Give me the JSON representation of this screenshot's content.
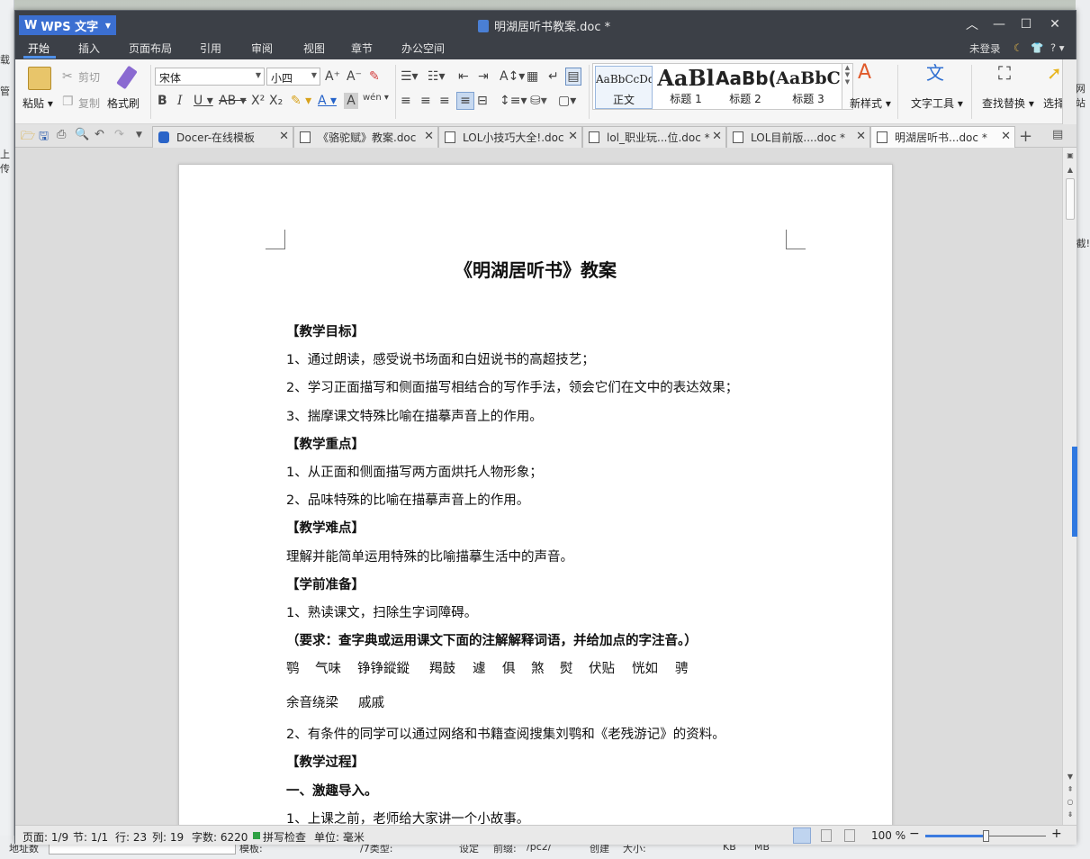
{
  "background": {
    "left_fragments": [
      "载",
      "管",
      "上传"
    ],
    "right_fragments": [
      "网站",
      "截!"
    ],
    "bottom_fragments": [
      "地址数",
      "模板:",
      "/7类型:",
      "设定",
      "前缀:",
      "/pc2/",
      "创建",
      "大小:",
      "KB",
      "MB"
    ]
  },
  "app": {
    "logo_label": "WPS 文字",
    "document_title": "明湖居听书教案.doc *"
  },
  "menu": {
    "items": [
      "开始",
      "插入",
      "页面布局",
      "引用",
      "审阅",
      "视图",
      "章节",
      "办公空间"
    ],
    "login": "未登录"
  },
  "ribbon": {
    "paste": "粘贴",
    "cut": "剪切",
    "copy": "复制",
    "format_painter": "格式刷",
    "font_name": "宋体",
    "font_size": "小四",
    "styles": [
      {
        "sample": "AaBbCcDd",
        "name": "正文"
      },
      {
        "sample": "AaBl",
        "name": "标题 1"
      },
      {
        "sample": "AaBb(",
        "name": "标题 2"
      },
      {
        "sample": "AaBbC",
        "name": "标题 3"
      }
    ],
    "new_style": "新样式",
    "text_tools": "文字工具",
    "find_replace": "查找替换",
    "select": "选择"
  },
  "tabs": [
    {
      "label": "Docer-在线模板",
      "active": false
    },
    {
      "label": "《骆驼赋》教案.doc",
      "active": false
    },
    {
      "label": "LOL小技巧大全!.doc",
      "active": false
    },
    {
      "label": "lol_职业玩...位.doc *",
      "active": false
    },
    {
      "label": "LOL目前版....doc *",
      "active": false
    },
    {
      "label": "明湖居听书...doc *",
      "active": true
    }
  ],
  "document": {
    "title": "《明湖居听书》教案",
    "lines": [
      "【教学目标】",
      "1、通过朗读，感受说书场面和白妞说书的高超技艺；",
      "2、学习正面描写和侧面描写相结合的写作手法，领会它们在文中的表达效果；",
      "3、揣摩课文特殊比喻在描摹声音上的作用。",
      "【教学重点】",
      "1、从正面和侧面描写两方面烘托人物形象；",
      "2、品味特殊的比喻在描摹声音上的作用。",
      "【教学难点】",
      "理解并能简单运用特殊的比喻描摹生活中的声音。",
      "【学前准备】",
      "1、熟读课文，扫除生字词障碍。",
      "（要求：查字典或运用课文下面的注解解释词语，并给加点的字注音。）",
      "2、有条件的同学可以通过网络和书籍查阅搜集刘鹗和《老残游记》的资料。",
      "【教学过程】",
      "一、激趣导入。",
      "1、上课之前，老师给大家讲一个小故事。"
    ],
    "vocab_row1": [
      "鹗",
      "气味",
      "铮铮鏦鏦",
      "羯鼓",
      "遽",
      "俱",
      "煞",
      "熨",
      "伏贴",
      "恍如",
      "骋"
    ],
    "vocab_row2": [
      "余音绕梁",
      "戚戚"
    ]
  },
  "status": {
    "page": "页面: 1/9",
    "section": "节: 1/1",
    "row": "行: 23",
    "col": "列: 19",
    "words": "字数: 6220",
    "spell": "拼写检查",
    "unit": "单位: 毫米",
    "zoom": "100 %",
    "zoom_fraction": 0.5
  }
}
